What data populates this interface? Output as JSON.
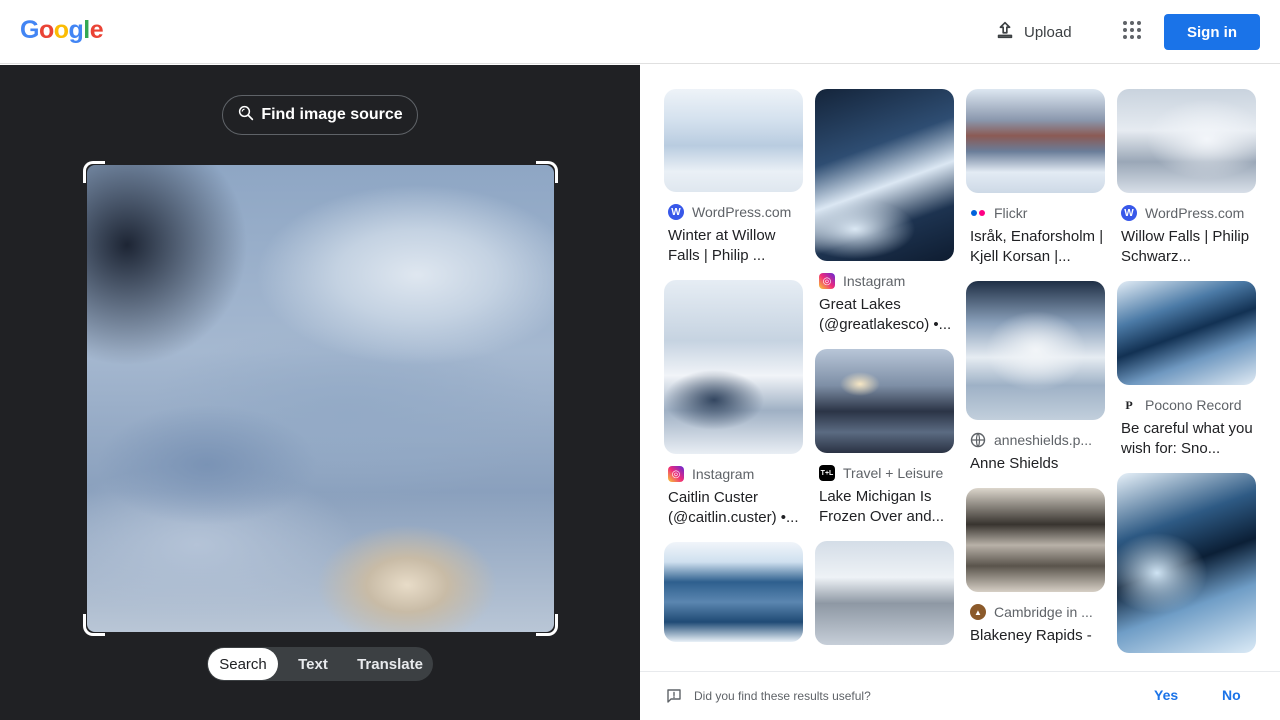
{
  "header": {
    "logo_letters": [
      {
        "char": "G",
        "color": "#4285F4"
      },
      {
        "char": "o",
        "color": "#EA4335"
      },
      {
        "char": "o",
        "color": "#FBBC05"
      },
      {
        "char": "g",
        "color": "#4285F4"
      },
      {
        "char": "l",
        "color": "#34A853"
      },
      {
        "char": "e",
        "color": "#EA4335"
      }
    ],
    "upload_label": "Upload",
    "upload_icon": "upload-icon",
    "apps_icon": "apps-grid-icon",
    "signin_label": "Sign in",
    "accent_color": "#1a73e8"
  },
  "query": {
    "find_source_label": "Find image source",
    "find_source_icon": "lens-search-icon",
    "tabs": [
      {
        "label": "Search",
        "active": true
      },
      {
        "label": "Text",
        "active": false
      },
      {
        "label": "Translate",
        "active": false
      }
    ]
  },
  "results": {
    "columns": [
      [
        {
          "source": "WordPress.com",
          "icon": "wordpress-icon",
          "title": "Winter at Willow Falls | Philip ..."
        },
        {
          "source": "Instagram",
          "icon": "instagram-icon",
          "title": "Caitlin Custer (@caitlin.custer) •..."
        },
        {
          "source": "",
          "icon": "",
          "title": ""
        }
      ],
      [
        {
          "source": "Instagram",
          "icon": "instagram-icon",
          "title": "Great Lakes (@greatlakesco) •..."
        },
        {
          "source": "Travel + Leisure",
          "icon": "travel-leisure-icon",
          "title": "Lake Michigan Is Frozen Over and..."
        },
        {
          "source": "",
          "icon": "",
          "title": ""
        }
      ],
      [
        {
          "source": "Flickr",
          "icon": "flickr-icon",
          "title": "Isråk, Enaforsholm | Kjell Korsan |..."
        },
        {
          "source": "anneshields.p...",
          "icon": "globe-icon",
          "title": "Anne Shields"
        },
        {
          "source": "Cambridge in ...",
          "icon": "cambridge-icon",
          "title": "Blakeney Rapids -"
        }
      ],
      [
        {
          "source": "WordPress.com",
          "icon": "wordpress-icon",
          "title": "Willow Falls | Philip Schwarz..."
        },
        {
          "source": "Pocono Record",
          "icon": "pocono-record-icon",
          "title": "Be careful what you wish for: Sno..."
        },
        {
          "source": "",
          "icon": "",
          "title": ""
        }
      ]
    ]
  },
  "feedback": {
    "question": "Did you find these results useful?",
    "yes_label": "Yes",
    "no_label": "No",
    "icon": "feedback-icon"
  }
}
